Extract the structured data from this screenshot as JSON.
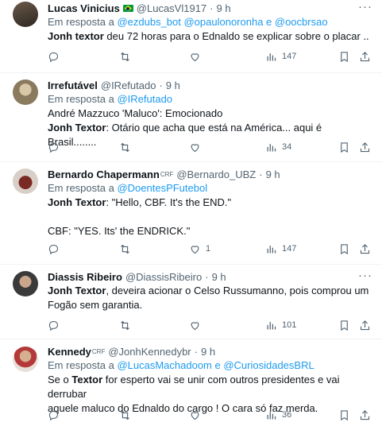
{
  "tweets": [
    {
      "name": "Lucas Vinicius",
      "badge": "",
      "handle": "@LucasVl1917",
      "time": "9 h",
      "reply_prefix": "Em resposta a",
      "reply_mentions": "@ezdubs_bot @opaulonoronha e @oocbrsao",
      "lines": [
        {
          "bold": "Jonh textor",
          "rest": " deu 72 horas para o Ednaldo se explicar sobre o placar .."
        }
      ],
      "replies": "",
      "retweets": "",
      "likes": "",
      "views": "147"
    },
    {
      "name": "Irrefutável",
      "badge": "",
      "handle": "@IRefutado",
      "time": "9 h",
      "reply_prefix": "Em resposta a",
      "reply_mentions": "@IRefutado",
      "lines": [
        {
          "bold": "",
          "rest": "André Mazzuco 'Maluco': Emocionado"
        },
        {
          "bold": "Jonh Textor",
          "rest": ": Otário que acha que está na América... aqui é Brasil........"
        }
      ],
      "replies": "",
      "retweets": "",
      "likes": "",
      "views": "34"
    },
    {
      "name": "Bernardo Chapermann",
      "badge": "CRF",
      "handle": "@Bernardo_UBZ",
      "time": "9 h",
      "reply_prefix": "Em resposta a",
      "reply_mentions": "@DoentesPFutebol",
      "lines": [
        {
          "bold": "Jonh Textor",
          "rest": ": \"Hello, CBF. It's the END.\""
        },
        {
          "bold": "",
          "rest": ""
        },
        {
          "bold": "",
          "rest": "CBF: \"YES. Its' the ENDRICK.\""
        }
      ],
      "replies": "",
      "retweets": "",
      "likes": "1",
      "views": "147"
    },
    {
      "name": "Diassis Ribeiro",
      "badge": "",
      "handle": "@DiassisRibeiro",
      "time": "9 h",
      "reply_prefix": "",
      "reply_mentions": "",
      "lines": [
        {
          "bold": "Jonh Textor",
          "rest": ", deveira acionar o Celso Russumanno, pois comprou um"
        },
        {
          "bold": "",
          "rest": "Fogão sem garantia."
        }
      ],
      "replies": "",
      "retweets": "",
      "likes": "",
      "views": "101"
    },
    {
      "name": "Kennedy",
      "badge": "CRF",
      "handle": "@JonhKennedybr",
      "time": "9 h",
      "reply_prefix": "Em resposta a",
      "reply_mentions": "@LucasMachadoom e @CuriosidadesBRL",
      "lines": [
        {
          "bold": "",
          "rest": "Se o ",
          "bold2": "Textor",
          "rest2": " for esperto vai se unir com outros presidentes e vai derrubar"
        },
        {
          "bold": "",
          "rest": "aquele maluco do Ednaldo do cargo ! O cara só faz merda."
        }
      ],
      "replies": "",
      "retweets": "",
      "likes": "",
      "views": "36"
    }
  ],
  "icons": {
    "reply": "reply-icon",
    "retweet": "retweet-icon",
    "like": "heart-icon",
    "views": "views-icon",
    "bookmark": "bookmark-icon",
    "share": "share-icon",
    "more": "more-icon",
    "flag": "brazil-flag-icon"
  },
  "colors": {
    "link": "#1d9bf0",
    "muted": "#536471",
    "text": "#0f1419"
  }
}
